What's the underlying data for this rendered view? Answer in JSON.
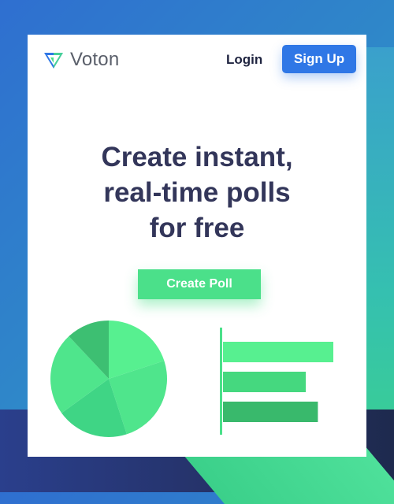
{
  "brand": {
    "name": "Voton",
    "logo_icon": "v-check-logo-icon",
    "colors": {
      "left": "#2f77e6",
      "right": "#4be08a"
    }
  },
  "nav": {
    "login_label": "Login",
    "signup_label": "Sign Up"
  },
  "hero": {
    "headline_lines": [
      "Create instant,",
      "real-time polls",
      "for free"
    ],
    "cta_label": "Create Poll"
  },
  "illustration": {
    "pie_slices": [
      {
        "fraction": 0.2,
        "color": "#57f090"
      },
      {
        "fraction": 0.25,
        "color": "#4fe58c"
      },
      {
        "fraction": 0.2,
        "color": "#3fd585"
      },
      {
        "fraction": 0.23,
        "color": "#4fe58c"
      },
      {
        "fraction": 0.12,
        "color": "#3dbf72"
      }
    ],
    "bar_fractions": [
      1.0,
      0.75,
      0.86
    ],
    "bar_colors": [
      "#57f090",
      "#45d87f",
      "#39b96c"
    ],
    "axis_color": "#4be08a"
  },
  "colors": {
    "accent": "#2f77e6",
    "cta": "#4be08a",
    "headline": "#33365a"
  }
}
